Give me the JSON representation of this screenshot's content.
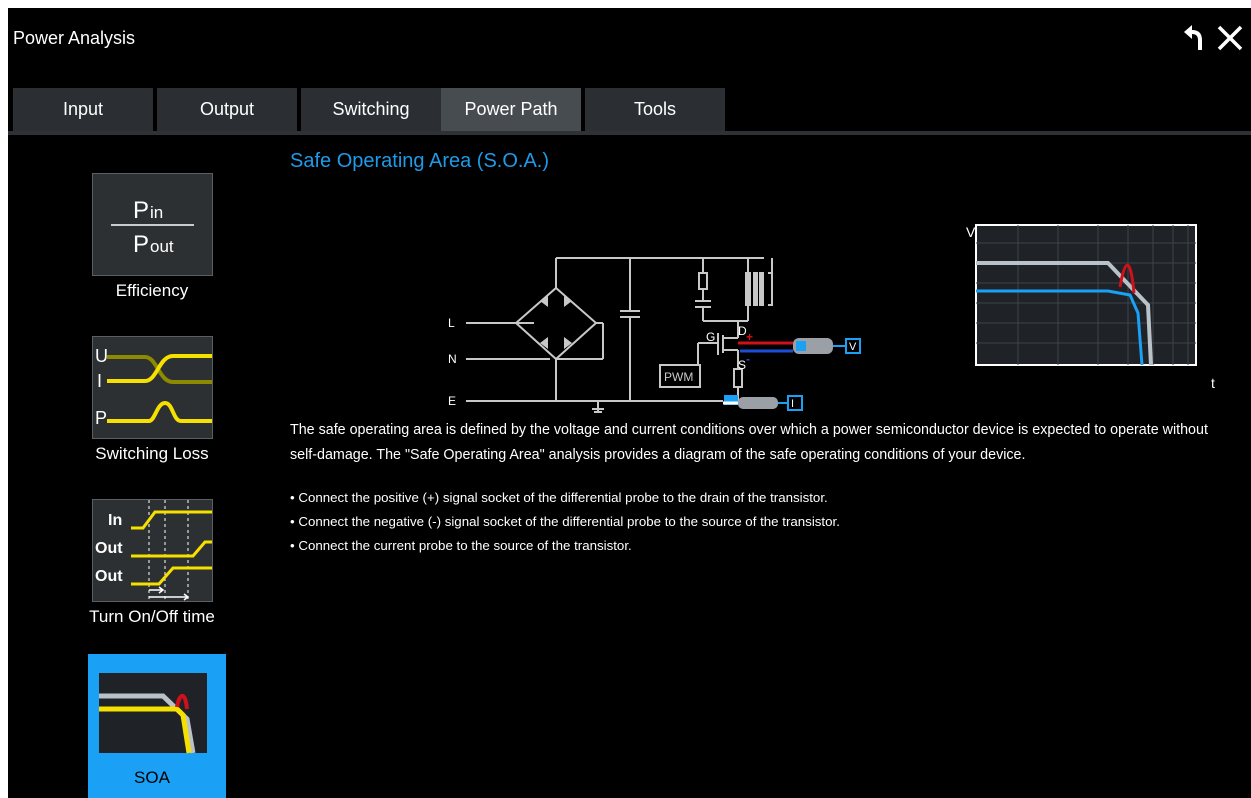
{
  "window": {
    "title": "Power Analysis",
    "undo_icon": "undo-arrow-icon",
    "close_icon": "close-icon"
  },
  "tabs": [
    {
      "label": "Input"
    },
    {
      "label": "Output"
    },
    {
      "label": "Switching"
    },
    {
      "label": "Power Path",
      "active": true
    },
    {
      "label": "Tools"
    }
  ],
  "sidebar": {
    "items": [
      {
        "label": "Efficiency",
        "icon": "efficiency-icon",
        "formula_top": "P",
        "formula_top_sub": "in",
        "formula_bottom": "P",
        "formula_bottom_sub": "out"
      },
      {
        "label": "Switching Loss",
        "icon": "switching-loss-icon",
        "signals": [
          "U",
          "I",
          "P"
        ]
      },
      {
        "label": "Turn On/Off time",
        "icon": "turn-on-off-time-icon",
        "signals": [
          "In",
          "Out",
          "Out"
        ]
      },
      {
        "label": "SOA",
        "icon": "soa-icon",
        "active": true
      }
    ]
  },
  "main": {
    "heading": "Safe Operating Area (S.O.A.)",
    "circuit": {
      "labels": {
        "l": "L",
        "n": "N",
        "e": "E",
        "g": "G",
        "d": "D",
        "s": "S",
        "pwm": "PWM",
        "probe_v": "V",
        "probe_i": "I",
        "plus": "+",
        "minus": "-"
      }
    },
    "soa_chart": {
      "x_axis": "t",
      "y_axis": "V"
    },
    "description": "The safe operating area is defined by the voltage and current conditions over which a power semiconductor device is expected to operate without self-damage. The \"Safe Operating Area\" analysis provides a diagram of the safe operating conditions of your device.",
    "bullets": [
      "Connect the positive (+) signal socket of the differential probe to the drain of the transistor.",
      "Connect the negative (-) signal socket of the differential probe to the source of the transistor.",
      "Connect the current probe to the source of the transistor."
    ]
  },
  "colors": {
    "accent": "#1aa0f5",
    "heading": "#1e9be8",
    "yellow": "#f5e000",
    "red": "#d0101a",
    "tab_bg": "#2b2f33",
    "tab_active": "#474c51"
  }
}
